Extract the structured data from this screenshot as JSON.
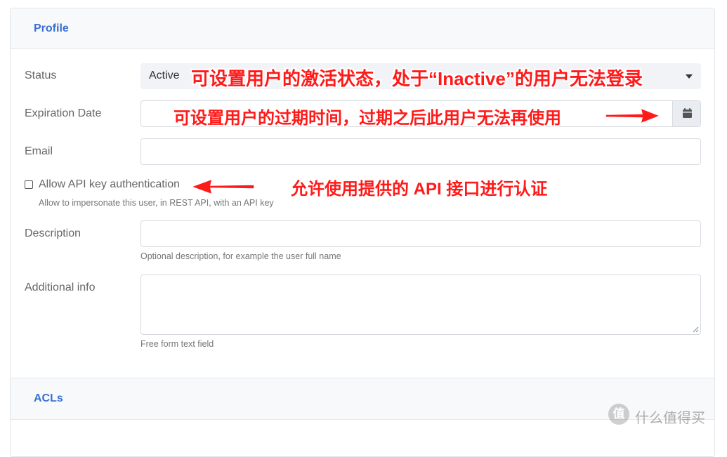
{
  "sections": {
    "profile_title": "Profile",
    "acls_title": "ACLs"
  },
  "form": {
    "status": {
      "label": "Status",
      "value": "Active"
    },
    "expiration": {
      "label": "Expiration Date",
      "value": ""
    },
    "email": {
      "label": "Email",
      "value": ""
    },
    "api_key": {
      "label": "Allow API key authentication",
      "help": "Allow to impersonate this user, in REST API, with an API key",
      "checked": false
    },
    "description": {
      "label": "Description",
      "value": "",
      "help": "Optional description, for example the user full name"
    },
    "additional_info": {
      "label": "Additional info",
      "value": "",
      "help": "Free form text field"
    }
  },
  "annotations": {
    "status_note": "可设置用户的激活状态，处于“Inactive”的用户无法登录",
    "expiration_note": "可设置用户的过期时间，过期之后此用户无法再使用",
    "api_note": "允许使用提供的 API 接口进行认证",
    "color": "#ff1a1a"
  },
  "watermark": {
    "logo_char": "值",
    "text": "什么值得买"
  },
  "icons": {
    "calendar": "calendar-icon",
    "caret": "caret-down-icon",
    "arrow": "red-arrow-icon"
  },
  "colors": {
    "accent": "#3a6fd1",
    "header_bg": "#f8f9fb",
    "border": "#d7dbe0"
  }
}
